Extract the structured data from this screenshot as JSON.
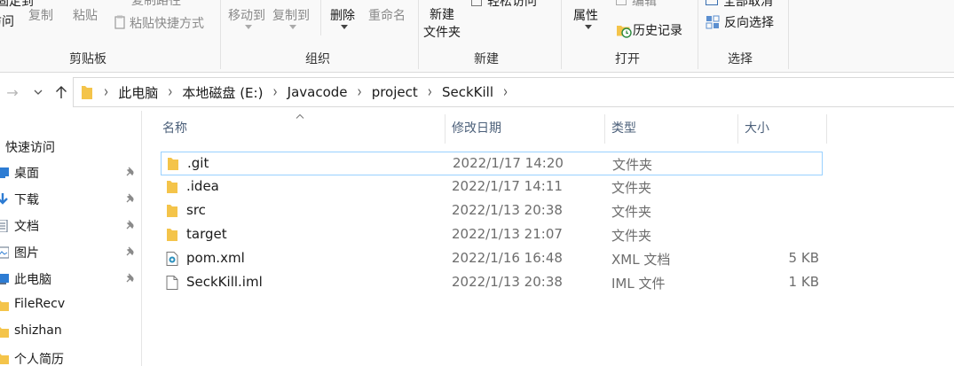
{
  "ribbon": {
    "clipboard": {
      "pin_label_l1": "固定到",
      "pin_label_l2": "访问",
      "copy_label": "复制",
      "paste_label": "粘贴",
      "copy_path_label": "复制路径",
      "paste_shortcut_label": "粘贴快捷方式",
      "group_label": "剪贴板"
    },
    "organize": {
      "move_to_label": "移动到",
      "copy_to_label": "复制到",
      "delete_label": "删除",
      "rename_label": "重命名",
      "group_label": "组织"
    },
    "new": {
      "new_folder_l1": "新建",
      "new_folder_l2": "文件夹",
      "easy_access_label": "轻松访问",
      "group_label": "新建"
    },
    "open": {
      "properties_label": "属性",
      "edit_label": "编辑",
      "history_label": "历史记录",
      "group_label": "打开"
    },
    "select": {
      "select_none_label": "全部取消",
      "invert_label": "反向选择",
      "group_label": "选择"
    }
  },
  "address": {
    "crumbs": [
      "此电脑",
      "本地磁盘 (E:)",
      "Javacode",
      "project",
      "SeckKill"
    ]
  },
  "nav": {
    "quick_access": "快速访问",
    "items": [
      {
        "label": "桌面",
        "icon": "desktop-icon",
        "pinned": true
      },
      {
        "label": "下载",
        "icon": "download-icon",
        "pinned": true
      },
      {
        "label": "文档",
        "icon": "document-icon",
        "pinned": true
      },
      {
        "label": "图片",
        "icon": "pictures-icon",
        "pinned": true
      },
      {
        "label": "此电脑",
        "icon": "computer-icon",
        "pinned": true
      },
      {
        "label": "FileRecv",
        "icon": "folder-icon",
        "pinned": false
      },
      {
        "label": "shizhan",
        "icon": "folder-icon",
        "pinned": false
      },
      {
        "label": "个人简历",
        "icon": "folder-icon",
        "pinned": false
      }
    ]
  },
  "columns": {
    "name": "名称",
    "date": "修改日期",
    "type": "类型",
    "size": "大小"
  },
  "files": [
    {
      "name": ".git",
      "date": "2022/1/17 14:20",
      "type": "文件夹",
      "size": "",
      "icon": "folder-icon",
      "selected": true
    },
    {
      "name": ".idea",
      "date": "2022/1/17 14:11",
      "type": "文件夹",
      "size": "",
      "icon": "folder-icon",
      "selected": false
    },
    {
      "name": "src",
      "date": "2022/1/13 20:38",
      "type": "文件夹",
      "size": "",
      "icon": "folder-icon",
      "selected": false
    },
    {
      "name": "target",
      "date": "2022/1/13 21:07",
      "type": "文件夹",
      "size": "",
      "icon": "folder-icon",
      "selected": false
    },
    {
      "name": "pom.xml",
      "date": "2022/1/16 16:48",
      "type": "XML 文档",
      "size": "5 KB",
      "icon": "xml-file-icon",
      "selected": false
    },
    {
      "name": "SeckKill.iml",
      "date": "2022/1/13 20:38",
      "type": "IML 文件",
      "size": "1 KB",
      "icon": "file-icon",
      "selected": false
    }
  ],
  "colors": {
    "folder": "#f4c44a",
    "selection_border": "#99d1ff",
    "header_text": "#4c607a"
  }
}
